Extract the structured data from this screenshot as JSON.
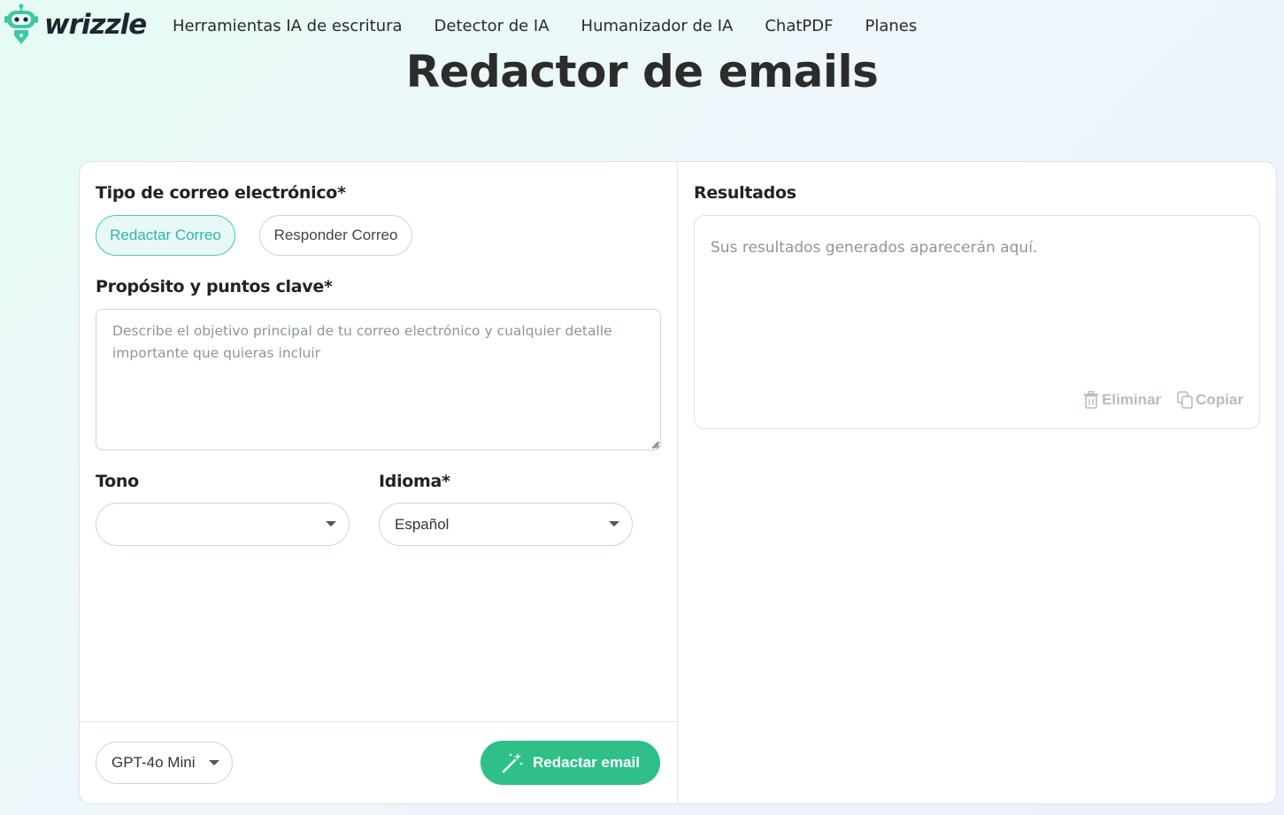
{
  "brand": {
    "name": "wrizzle"
  },
  "nav": {
    "items": [
      {
        "label": "Herramientas IA de escritura"
      },
      {
        "label": "Detector de IA"
      },
      {
        "label": "Humanizador de IA"
      },
      {
        "label": "ChatPDF"
      },
      {
        "label": "Planes"
      }
    ]
  },
  "page": {
    "title": "Redactor de emails"
  },
  "form": {
    "email_type": {
      "label": "Tipo de correo electrónico*",
      "options": [
        {
          "label": "Redactar Correo",
          "selected": true
        },
        {
          "label": "Responder Correo",
          "selected": false
        }
      ]
    },
    "purpose": {
      "label": "Propósito y puntos clave*",
      "placeholder": "Describe el objetivo principal de tu correo electrónico y cualquier detalle importante que quieras incluir",
      "value": ""
    },
    "tone": {
      "label": "Tono",
      "value": ""
    },
    "language": {
      "label": "Idioma*",
      "value": "Español"
    },
    "model": {
      "value": "GPT-4o Mini"
    },
    "submit_label": "Redactar email"
  },
  "results": {
    "label": "Resultados",
    "placeholder": "Sus resultados generados aparecerán aquí.",
    "actions": {
      "delete_label": "Eliminar",
      "copy_label": "Copiar"
    }
  },
  "colors": {
    "accent_green": "#2fc08a",
    "accent_teal": "#2fb7a6",
    "logo_teal": "#3cc8a4"
  },
  "icons": [
    "robot-logo-icon",
    "caret-down-icon",
    "magic-wand-icon",
    "trash-icon",
    "copy-icon",
    "resize-grip-icon"
  ]
}
